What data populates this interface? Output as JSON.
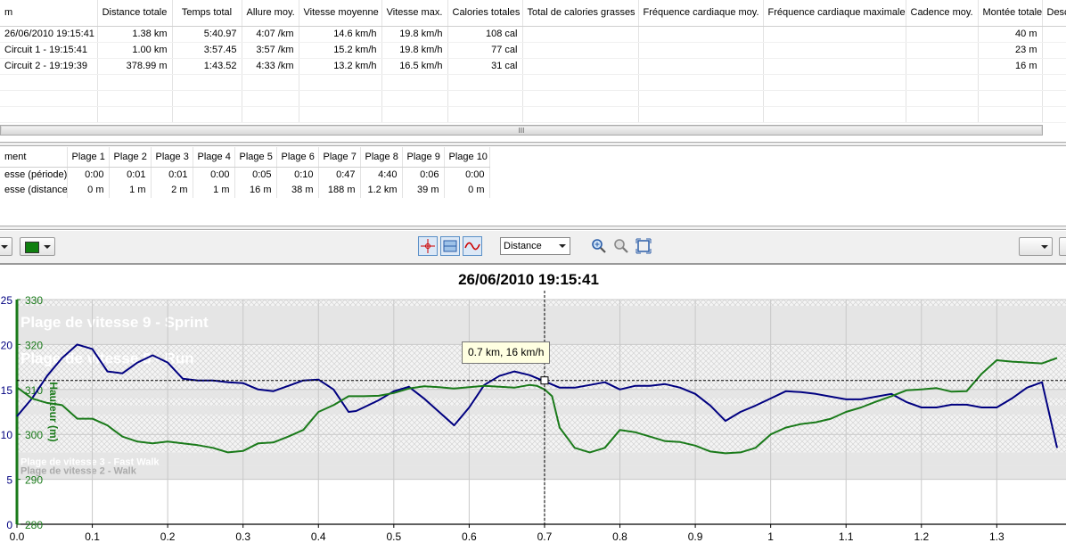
{
  "laps": {
    "headers": [
      "m",
      "Distance totale",
      "Temps total",
      "Allure moy.",
      "Vitesse moyenne",
      "Vitesse max.",
      "Calories totales",
      "Total de calories grasses",
      "Fréquence cardiaque moy.",
      "Fréquence cardiaque maximale",
      "Cadence moy.",
      "Montée totale",
      "Desc"
    ],
    "rows": [
      [
        "26/06/2010 19:15:41",
        "1.38 km",
        "5:40.97",
        "4:07 /km",
        "14.6 km/h",
        "19.8 km/h",
        "108 cal",
        "",
        "",
        "",
        "",
        "40 m",
        ""
      ],
      [
        "Circuit 1 - 19:15:41",
        "1.00 km",
        "3:57.45",
        "3:57 /km",
        "15.2 km/h",
        "19.8 km/h",
        "77 cal",
        "",
        "",
        "",
        "",
        "23 m",
        ""
      ],
      [
        "Circuit 2 - 19:19:39",
        "378.99 m",
        "1:43.52",
        "4:33 /km",
        "13.2 km/h",
        "16.5 km/h",
        "31 cal",
        "",
        "",
        "",
        "",
        "16 m",
        ""
      ]
    ]
  },
  "scroll_grip": "III",
  "zones": {
    "headers": [
      "ment",
      "Plage 1",
      "Plage 2",
      "Plage 3",
      "Plage 4",
      "Plage 5",
      "Plage 6",
      "Plage 7",
      "Plage 8",
      "Plage 9",
      "Plage 10"
    ],
    "rows": [
      [
        "esse (période)",
        "0:00",
        "0:01",
        "0:01",
        "0:00",
        "0:05",
        "0:10",
        "0:47",
        "4:40",
        "0:06",
        "0:00"
      ],
      [
        "esse (distance)",
        "0 m",
        "1 m",
        "2 m",
        "1 m",
        "16 m",
        "38 m",
        "188 m",
        "1.2 km",
        "39 m",
        "0 m"
      ]
    ]
  },
  "toolbar": {
    "x_axis_select": "Distance",
    "color_swatch": "#0f7f0f"
  },
  "chart": {
    "title": "26/06/2010 19:15:41",
    "tooltip": "0.7 km, 16 km/h",
    "zone_labels": [
      "Plage de vitesse 9 - Sprint",
      "Plage de vitesse 8 - Run",
      "Plage de vitesse 3 - Fast Walk",
      "Plage de vitesse 2 - Walk"
    ],
    "elevation_axis_label": "Hauteur (m)"
  },
  "chart_data": {
    "type": "line",
    "title": "26/06/2010 19:15:41",
    "xlabel": "",
    "x_ticks": [
      "0.0",
      "0.1",
      "0.2",
      "0.3",
      "0.4",
      "0.5",
      "0.6",
      "0.7",
      "0.8",
      "0.9",
      "1",
      "1.1",
      "1.2",
      "1.3",
      "1"
    ],
    "xlim": [
      0,
      1.38
    ],
    "y1_ticks": [
      "25",
      "20",
      "15",
      "10",
      "5",
      "0"
    ],
    "y1lim": [
      0,
      25
    ],
    "y1_color": "#000080",
    "y2_ticks": [
      "330",
      "320",
      "310",
      "300",
      "290",
      "280"
    ],
    "y2lim": [
      280,
      330
    ],
    "y2label": "Hauteur (m)",
    "y2_color": "#1a7a1a",
    "grid": true,
    "crosshair": {
      "x": 0.7,
      "y": 16
    },
    "speed_zones": [
      {
        "label": "Plage de vitesse 9 - Sprint",
        "from": 20,
        "to": 25
      },
      {
        "label": "Plage de vitesse 8 - Run",
        "from": 15,
        "to": 20
      },
      {
        "label": "Plage de vitesse 3 - Fast Walk",
        "from": 6.5,
        "to": 8
      },
      {
        "label": "Plage de vitesse 2 - Walk",
        "from": 5,
        "to": 6.5
      }
    ],
    "series": [
      {
        "axis": "y1",
        "x": [
          0,
          0.02,
          0.04,
          0.06,
          0.08,
          0.1,
          0.12,
          0.14,
          0.16,
          0.18,
          0.2,
          0.22,
          0.24,
          0.26,
          0.28,
          0.3,
          0.32,
          0.34,
          0.36,
          0.38,
          0.4,
          0.42,
          0.44,
          0.45,
          0.46,
          0.48,
          0.5,
          0.52,
          0.54,
          0.56,
          0.58,
          0.6,
          0.62,
          0.64,
          0.66,
          0.68,
          0.7,
          0.72,
          0.74,
          0.76,
          0.78,
          0.8,
          0.82,
          0.84,
          0.86,
          0.88,
          0.9,
          0.92,
          0.94,
          0.96,
          0.98,
          1.0,
          1.02,
          1.04,
          1.06,
          1.08,
          1.1,
          1.12,
          1.14,
          1.16,
          1.18,
          1.2,
          1.22,
          1.24,
          1.26,
          1.28,
          1.3,
          1.32,
          1.34,
          1.36,
          1.38
        ],
        "y": [
          12,
          14,
          16.5,
          18.5,
          20,
          19.5,
          17,
          16.8,
          18,
          18.8,
          18,
          16.2,
          16,
          16,
          15.8,
          15.7,
          15,
          14.8,
          15.4,
          16,
          16.1,
          15,
          12.5,
          12.6,
          13,
          13.8,
          14.8,
          15.3,
          14,
          12.5,
          11,
          13,
          15.5,
          16.5,
          17,
          16.6,
          15.9,
          15.2,
          15.2,
          15.5,
          15.8,
          15,
          15.4,
          15.4,
          15.6,
          15.2,
          14.5,
          13.2,
          11.5,
          12.5,
          13.2,
          14,
          14.8,
          14.7,
          14.5,
          14.2,
          13.9,
          13.9,
          14.2,
          14.5,
          13.6,
          13,
          13,
          13.3,
          13.3,
          13,
          13,
          14,
          15.2,
          15.8,
          8.5
        ]
      },
      {
        "axis": "y2",
        "x": [
          0,
          0.02,
          0.04,
          0.06,
          0.08,
          0.1,
          0.12,
          0.14,
          0.16,
          0.18,
          0.2,
          0.22,
          0.24,
          0.26,
          0.28,
          0.3,
          0.32,
          0.34,
          0.36,
          0.38,
          0.4,
          0.42,
          0.44,
          0.46,
          0.48,
          0.5,
          0.52,
          0.54,
          0.56,
          0.58,
          0.6,
          0.62,
          0.64,
          0.66,
          0.68,
          0.69,
          0.7,
          0.71,
          0.72,
          0.74,
          0.76,
          0.78,
          0.8,
          0.82,
          0.84,
          0.86,
          0.88,
          0.9,
          0.92,
          0.94,
          0.96,
          0.98,
          1.0,
          1.02,
          1.04,
          1.06,
          1.08,
          1.1,
          1.12,
          1.14,
          1.16,
          1.18,
          1.2,
          1.22,
          1.24,
          1.26,
          1.28,
          1.3,
          1.32,
          1.34,
          1.36,
          1.38
        ],
        "y": [
          310.5,
          308,
          307,
          306.5,
          303.5,
          303.5,
          302,
          299.5,
          298.4,
          298,
          298.4,
          298,
          297.6,
          297,
          296,
          296.3,
          298,
          298.2,
          299.5,
          301,
          305,
          306.5,
          308.5,
          308.5,
          308.6,
          309.2,
          310.2,
          310.7,
          310.5,
          310.2,
          310.5,
          310.8,
          310.6,
          310.4,
          311,
          310.8,
          310,
          308.5,
          301.5,
          297,
          296,
          297,
          301,
          300.5,
          299.5,
          298.5,
          298.3,
          297.5,
          296.2,
          295.8,
          296,
          297,
          300,
          301.5,
          302.3,
          302.7,
          303.5,
          305,
          306,
          307.3,
          308.5,
          309.8,
          310,
          310.3,
          309.5,
          309.6,
          313.5,
          316.5,
          316.2,
          316,
          315.8,
          317
        ]
      }
    ]
  }
}
